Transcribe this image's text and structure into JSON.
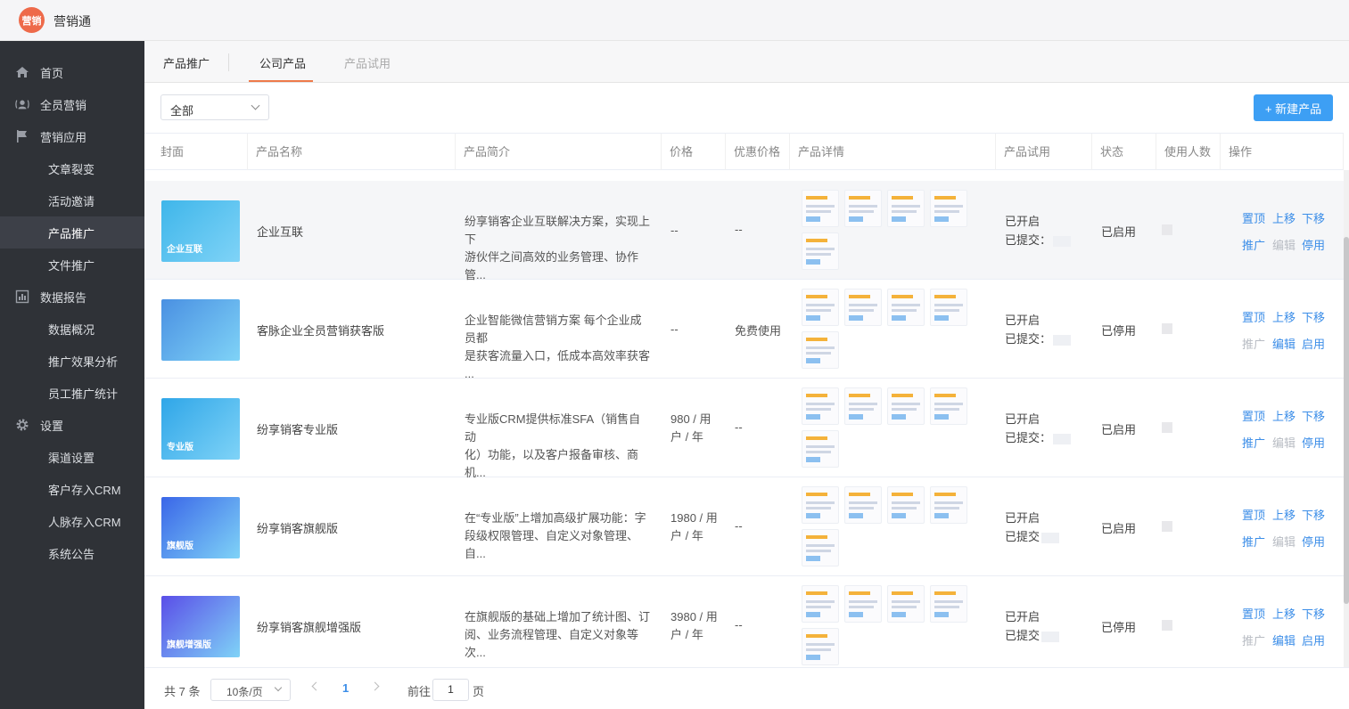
{
  "app": {
    "logo_text": "营销",
    "name": "营销通"
  },
  "sidebar": {
    "items": [
      {
        "label": "首页",
        "type": "group",
        "icon": "home-icon"
      },
      {
        "label": "全员营销",
        "type": "group",
        "icon": "people-icon"
      },
      {
        "label": "营销应用",
        "type": "group",
        "icon": "flag-icon"
      },
      {
        "label": "文章裂变",
        "type": "sub"
      },
      {
        "label": "活动邀请",
        "type": "sub"
      },
      {
        "label": "产品推广",
        "type": "sub",
        "active": true
      },
      {
        "label": "文件推广",
        "type": "sub"
      },
      {
        "label": "数据报告",
        "type": "group",
        "icon": "report-icon"
      },
      {
        "label": "数据概况",
        "type": "sub"
      },
      {
        "label": "推广效果分析",
        "type": "sub"
      },
      {
        "label": "员工推广统计",
        "type": "sub"
      },
      {
        "label": "设置",
        "type": "group",
        "icon": "gear-icon"
      },
      {
        "label": "渠道设置",
        "type": "sub"
      },
      {
        "label": "客户存入CRM",
        "type": "sub"
      },
      {
        "label": "人脉存入CRM",
        "type": "sub"
      },
      {
        "label": "系统公告",
        "type": "sub"
      }
    ]
  },
  "tabs": {
    "t1": "产品推广",
    "t2": "公司产品",
    "t3": "产品试用"
  },
  "filter": {
    "value": "全部"
  },
  "toolbar": {
    "new_label": "+ 新建产品"
  },
  "table": {
    "headers": [
      "封面",
      "产品名称",
      "产品简介",
      "价格",
      "优惠价格",
      "产品详情",
      "产品试用",
      "状态",
      "使用人数",
      "操作"
    ],
    "rows": [
      {
        "cover_text": "企业互联",
        "cover_color": "#3fb6ea",
        "name": "企业互联",
        "desc1": "纷享销客企业互联解决方案，实现上下",
        "desc2": "游伙伴之间高效的业务管理、协作管...",
        "price1": "--",
        "price2": "",
        "discount": "--",
        "trial1": "已开启",
        "trial2": "已提交：",
        "status": "已启用",
        "ops": [
          "置顶",
          "上移",
          "下移",
          "推广",
          "编辑",
          "停用"
        ],
        "disabled": [
          false,
          false,
          false,
          false,
          true,
          false
        ]
      },
      {
        "cover_text": "",
        "cover_color": "#4a90e2",
        "name": "客脉企业全员营销获客版",
        "desc1": "企业智能微信营销方案 每个企业成员都",
        "desc2": "是获客流量入口，低成本高效率获客 ...",
        "price1": "--",
        "price2": "",
        "discount": "免费使用",
        "trial1": "已开启",
        "trial2": "已提交：",
        "status": "已停用",
        "ops": [
          "置顶",
          "上移",
          "下移",
          "推广",
          "编辑",
          "启用"
        ],
        "disabled": [
          false,
          false,
          false,
          true,
          false,
          false
        ]
      },
      {
        "cover_text": "专业版",
        "cover_color": "#2fa6e8",
        "name": "纷享销客专业版",
        "desc1": "专业版CRM提供标准SFA（销售自动",
        "desc2": "化）功能，以及客户报备审核、商机...",
        "price1": "980 / 用",
        "price2": "户 / 年",
        "discount": "--",
        "trial1": "已开启",
        "trial2": "已提交：",
        "status": "已启用",
        "ops": [
          "置顶",
          "上移",
          "下移",
          "推广",
          "编辑",
          "停用"
        ],
        "disabled": [
          false,
          false,
          false,
          false,
          true,
          false
        ]
      },
      {
        "cover_text": "旗舰版",
        "cover_color": "#3a66e8",
        "name": "纷享销客旗舰版",
        "desc1": "在“专业版”上增加高级扩展功能：字",
        "desc2": "段级权限管理、自定义对象管理、自...",
        "price1": "1980 / 用",
        "price2": "户 / 年",
        "discount": "--",
        "trial1": "已开启",
        "trial2": "已提交",
        "status": "已启用",
        "ops": [
          "置顶",
          "上移",
          "下移",
          "推广",
          "编辑",
          "停用"
        ],
        "disabled": [
          false,
          false,
          false,
          false,
          true,
          false
        ]
      },
      {
        "cover_text": "旗舰增强版",
        "cover_color": "#5a4ee8",
        "name": "纷享销客旗舰增强版",
        "desc1": "在旗舰版的基础上增加了统计图、订",
        "desc2": "阅、业务流程管理、自定义对象等次...",
        "price1": "3980 / 用",
        "price2": "户 / 年",
        "discount": "--",
        "trial1": "已开启",
        "trial2": "已提交",
        "status": "已停用",
        "ops": [
          "置顶",
          "上移",
          "下移",
          "推广",
          "编辑",
          "启用"
        ],
        "disabled": [
          false,
          false,
          false,
          true,
          false,
          false
        ]
      }
    ]
  },
  "pager": {
    "total": "共 7 条",
    "page_size": "10条/页",
    "current": "1",
    "goto_label": "前往",
    "goto_value": "1",
    "page_suffix": "页"
  },
  "colors": {
    "accent": "#3d9ff4",
    "tab_underline": "#ee7a4a",
    "sidebar_bg": "#2f3237",
    "link": "#3c8ee8"
  }
}
